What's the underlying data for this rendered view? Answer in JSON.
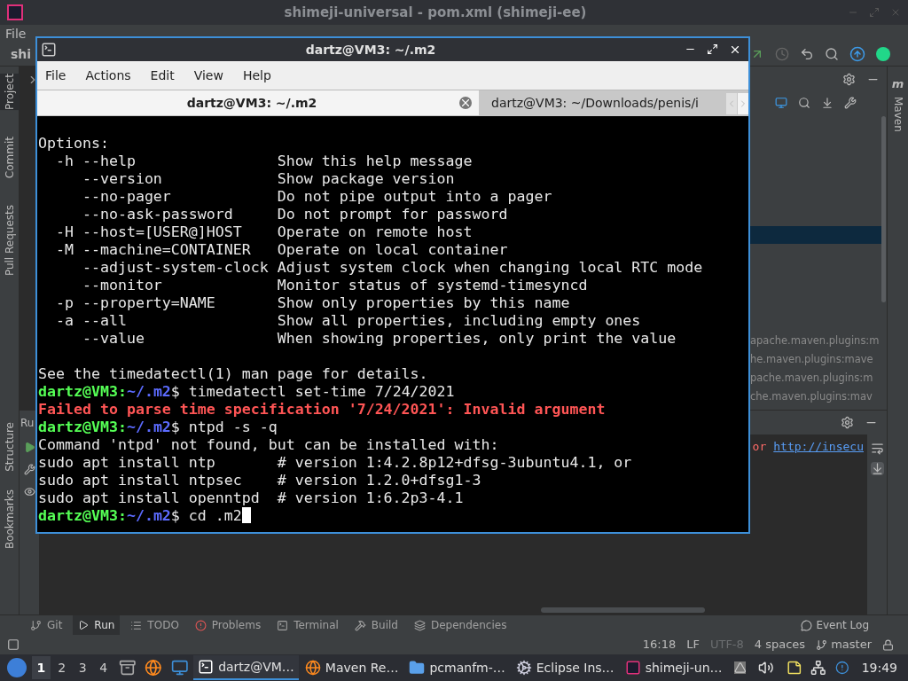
{
  "ide": {
    "title": "shimeji-universal - pom.xml (shimeji-ee)",
    "menu": [
      "File"
    ],
    "project_label": "shi",
    "left_tools_top": [
      {
        "label": "Project",
        "selected": true
      },
      {
        "label": "Commit",
        "selected": false
      },
      {
        "label": "Pull Requests",
        "selected": false
      }
    ],
    "left_tools_bottom": [
      {
        "label": "Structure",
        "selected": false
      },
      {
        "label": "Bookmarks",
        "selected": false
      }
    ],
    "right_tool": {
      "label": "Maven",
      "icon_text": "m"
    },
    "maven_lines": [
      "apache.maven.plugins:m",
      "he.maven.plugins:mave",
      "pache.maven.plugins:m",
      "che.maven.plugins:mav"
    ],
    "run_panel": {
      "title": "Ru",
      "console_prefix": "or",
      "console_link": "http://insecu"
    },
    "tool_tabs": [
      {
        "label": "Git",
        "selected": false
      },
      {
        "label": "Run",
        "selected": true
      },
      {
        "label": "TODO",
        "selected": false
      },
      {
        "label": "Problems",
        "selected": false
      },
      {
        "label": "Terminal",
        "selected": false
      },
      {
        "label": "Build",
        "selected": false
      },
      {
        "label": "Dependencies",
        "selected": false
      }
    ],
    "event_log": "Event Log",
    "status": [
      {
        "text": "16:18",
        "disabled": false
      },
      {
        "text": "LF",
        "disabled": false
      },
      {
        "text": "UTF-8",
        "disabled": true
      },
      {
        "text": "4 spaces",
        "disabled": false
      }
    ],
    "branch": "master"
  },
  "terminal": {
    "title": "dartz@VM3: ~/.m2",
    "menu": [
      "File",
      "Actions",
      "Edit",
      "View",
      "Help"
    ],
    "tabs": [
      {
        "label": "dartz@VM3: ~/.m2",
        "selected": true
      },
      {
        "label": "dartz@VM3: ~/Downloads/penis/i",
        "selected": false
      }
    ],
    "lines": [
      {
        "kind": "plain",
        "text": "Options:"
      },
      {
        "kind": "plain",
        "text": "  -h --help                Show this help message"
      },
      {
        "kind": "plain",
        "text": "     --version             Show package version"
      },
      {
        "kind": "plain",
        "text": "     --no-pager            Do not pipe output into a pager"
      },
      {
        "kind": "plain",
        "text": "     --no-ask-password     Do not prompt for password"
      },
      {
        "kind": "plain",
        "text": "  -H --host=[USER@]HOST    Operate on remote host"
      },
      {
        "kind": "plain",
        "text": "  -M --machine=CONTAINER   Operate on local container"
      },
      {
        "kind": "plain",
        "text": "     --adjust-system-clock Adjust system clock when changing local RTC mode"
      },
      {
        "kind": "plain",
        "text": "     --monitor             Monitor status of systemd-timesyncd"
      },
      {
        "kind": "plain",
        "text": "  -p --property=NAME       Show only properties by this name"
      },
      {
        "kind": "plain",
        "text": "  -a --all                 Show all properties, including empty ones"
      },
      {
        "kind": "plain",
        "text": "     --value               When showing properties, only print the value"
      },
      {
        "kind": "blank"
      },
      {
        "kind": "plain",
        "text": "See the timedatectl(1) man page for details."
      },
      {
        "kind": "prompt",
        "user": "dartz@VM3:",
        "path": "~/.m2",
        "sign": "$",
        "command": "timedatectl set-time 7/24/2021",
        "cursor": false
      },
      {
        "kind": "error",
        "text": "Failed to parse time specification '7/24/2021': Invalid argument"
      },
      {
        "kind": "prompt",
        "user": "dartz@VM3:",
        "path": "~/.m2",
        "sign": "$",
        "command": "ntpd -s -q",
        "cursor": false
      },
      {
        "kind": "plain",
        "text": "Command 'ntpd' not found, but can be installed with:"
      },
      {
        "kind": "plain",
        "text": "sudo apt install ntp       # version 1:4.2.8p12+dfsg-3ubuntu4.1, or"
      },
      {
        "kind": "plain",
        "text": "sudo apt install ntpsec    # version 1.2.0+dfsg1-3"
      },
      {
        "kind": "plain",
        "text": "sudo apt install openntpd  # version 1:6.2p3-4.1"
      },
      {
        "kind": "prompt",
        "user": "dartz@VM3:",
        "path": "~/.m2",
        "sign": "$",
        "command": "cd .m2",
        "cursor": true
      }
    ]
  },
  "taskbar": {
    "desktops": [
      {
        "label": "1",
        "selected": true
      },
      {
        "label": "2",
        "selected": false
      },
      {
        "label": "3",
        "selected": false
      },
      {
        "label": "4",
        "selected": false
      }
    ],
    "tasks": [
      {
        "label": "dartz@VM…",
        "selected": true
      },
      {
        "label": "Maven Re…",
        "selected": false
      },
      {
        "label": "pcmanfm-…",
        "selected": false
      },
      {
        "label": "Eclipse Ins…",
        "selected": false
      },
      {
        "label": "shimeji-un…",
        "selected": false
      }
    ],
    "clock": "19:49"
  }
}
